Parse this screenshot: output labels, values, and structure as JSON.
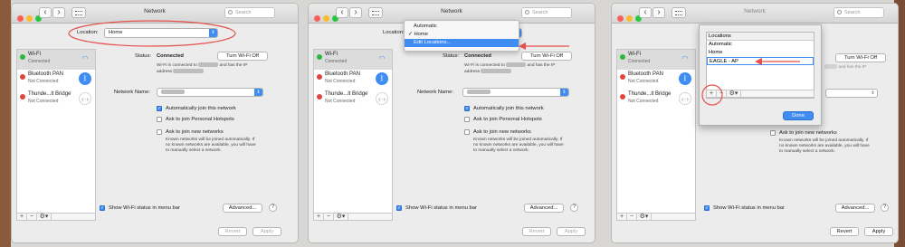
{
  "window": {
    "title": "Network",
    "search_placeholder": "Search"
  },
  "location": {
    "label": "Location:",
    "value": "Home"
  },
  "services": [
    {
      "name": "Wi-Fi",
      "status": "Connected",
      "color": "#2db83d"
    },
    {
      "name": "Bluetooth PAN",
      "status": "Not Connected",
      "color": "#e0443e"
    },
    {
      "name": "Thunde...lt Bridge",
      "status": "Not Connected",
      "color": "#e0443e"
    }
  ],
  "detail": {
    "status_label": "Status:",
    "status_value": "Connected",
    "turn_off_button": "Turn Wi-Fi Off",
    "status_desc_1": "Wi-Fi is connected to",
    "status_desc_2": "and has the IP",
    "status_desc_3": "address",
    "network_name_label": "Network Name:",
    "auto_join": "Automatically join this network",
    "ask_hotspots": "Ask to join Personal Hotspots",
    "ask_new": "Ask to join new networks",
    "known_networks_note_1": "Known networks will be joined automatically. If",
    "known_networks_note_2": "no known networks are available, you will have",
    "known_networks_note_3": "to manually select a network.",
    "show_status": "Show Wi-Fi status in menu bar",
    "advanced_button": "Advanced...",
    "help": "?",
    "revert_button": "Revert",
    "apply_button": "Apply"
  },
  "sidebar_controls": {
    "add": "+",
    "remove": "−",
    "gear": "⚙▾"
  },
  "location_menu": {
    "items": [
      "Automatic",
      "✓ Home",
      "Edit Locations..."
    ]
  },
  "locations_sheet": {
    "header": "Locations",
    "items": [
      "Automatic",
      "Home",
      "EAGLE - AP"
    ],
    "done_button": "Done"
  },
  "colors": {
    "accent": "#3f8cf2",
    "annotation": "#e5504b"
  }
}
